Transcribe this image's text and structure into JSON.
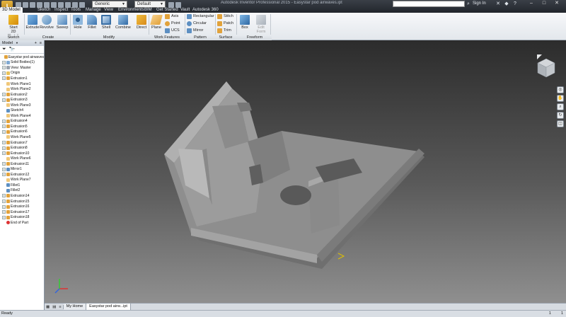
{
  "window": {
    "app_button": "I",
    "title": "Autodesk Inventor Professional 2015 - Easystar pod airwaves.ipt",
    "appearance_combo": "Generic",
    "material_combo": "Default",
    "search_placeholder": "",
    "sign_in": "Sign In"
  },
  "ribbon_tabs": [
    "3D Model",
    "Sketch",
    "Inspect",
    "Tools",
    "Manage",
    "View",
    "Environments",
    "BIM",
    "Get Started",
    "Vault",
    "Autodesk 360"
  ],
  "ribbon": {
    "sketch": {
      "start_sketch_line1": "Start",
      "start_sketch_line2": "2D Sketch",
      "panel": "Sketch"
    },
    "create": {
      "extrude": "Extrude",
      "revolve": "Revolve",
      "sweep": "Sweep",
      "panel": "Create"
    },
    "modify": {
      "hole": "Hole",
      "fillet": "Fillet",
      "shell": "Shell",
      "combine": "Combine",
      "direct": "Direct",
      "panel": "Modify"
    },
    "work_features": {
      "plane": "Plane",
      "axis": "Axis",
      "point": "Point",
      "ucs": "UCS",
      "panel": "Work Features"
    },
    "pattern": {
      "rectangular": "Rectangular",
      "circular": "Circular",
      "mirror": "Mirror",
      "panel": "Pattern"
    },
    "surface": {
      "stitch": "Stitch",
      "patch": "Patch",
      "trim": "Trim",
      "panel": "Surface"
    },
    "freeform": {
      "box": "Box",
      "edit_form_line1": "Edit",
      "edit_form_line2": "Form",
      "panel": "Freeform"
    }
  },
  "browser": {
    "header": "Model",
    "tree": [
      {
        "label": "Easystar pod airwaves",
        "icon": "part-icon",
        "expand": false,
        "indent": 0
      },
      {
        "label": "Solid Bodies(1)",
        "icon": "solid-bodies-icon",
        "expand": true,
        "indent": 1
      },
      {
        "label": "View: Master",
        "icon": "view-icon",
        "expand": true,
        "indent": 1
      },
      {
        "label": "Origin",
        "icon": "folder-icon",
        "expand": true,
        "indent": 1
      },
      {
        "label": "Extrusion1",
        "icon": "extrude-icon",
        "expand": true,
        "indent": 1
      },
      {
        "label": "Work Plane1",
        "icon": "work-plane-icon",
        "expand": false,
        "indent": 1
      },
      {
        "label": "Work Plane2",
        "icon": "work-plane-icon",
        "expand": false,
        "indent": 1
      },
      {
        "label": "Extrusion2",
        "icon": "extrude-icon",
        "expand": true,
        "indent": 1
      },
      {
        "label": "Extrusion3",
        "icon": "extrude-icon",
        "expand": true,
        "indent": 1
      },
      {
        "label": "Work Plane3",
        "icon": "work-plane-icon",
        "expand": false,
        "indent": 1
      },
      {
        "label": "Sketch4",
        "icon": "sketch-icon",
        "expand": false,
        "indent": 1
      },
      {
        "label": "Work Plane4",
        "icon": "work-plane-icon",
        "expand": false,
        "indent": 1
      },
      {
        "label": "Extrusion4",
        "icon": "extrude-icon",
        "expand": true,
        "indent": 1
      },
      {
        "label": "Extrusion5",
        "icon": "extrude-icon",
        "expand": true,
        "indent": 1
      },
      {
        "label": "Extrusion6",
        "icon": "extrude-icon",
        "expand": true,
        "indent": 1
      },
      {
        "label": "Work Plane5",
        "icon": "work-plane-icon",
        "expand": false,
        "indent": 1
      },
      {
        "label": "Extrusion7",
        "icon": "extrude-icon",
        "expand": true,
        "indent": 1
      },
      {
        "label": "Extrusion8",
        "icon": "extrude-icon",
        "expand": true,
        "indent": 1
      },
      {
        "label": "Extrusion10",
        "icon": "extrude-icon",
        "expand": true,
        "indent": 1
      },
      {
        "label": "Work Plane6",
        "icon": "work-plane-icon",
        "expand": false,
        "indent": 1
      },
      {
        "label": "Extrusion11",
        "icon": "extrude-icon",
        "expand": true,
        "indent": 1
      },
      {
        "label": "Mirror1",
        "icon": "mirror-icon",
        "expand": true,
        "indent": 1
      },
      {
        "label": "Extrusion12",
        "icon": "extrude-icon",
        "expand": true,
        "indent": 1
      },
      {
        "label": "Work Plane7",
        "icon": "work-plane-icon",
        "expand": false,
        "indent": 1
      },
      {
        "label": "Fillet1",
        "icon": "fillet-icon",
        "expand": false,
        "indent": 1
      },
      {
        "label": "Fillet2",
        "icon": "fillet-icon",
        "expand": false,
        "indent": 1
      },
      {
        "label": "Extrusion14",
        "icon": "extrude-icon",
        "expand": true,
        "indent": 1
      },
      {
        "label": "Extrusion15",
        "icon": "extrude-icon",
        "expand": true,
        "indent": 1
      },
      {
        "label": "Extrusion16",
        "icon": "extrude-icon",
        "expand": true,
        "indent": 1
      },
      {
        "label": "Extrusion17",
        "icon": "extrude-icon",
        "expand": true,
        "indent": 1
      },
      {
        "label": "Extrusion18",
        "icon": "extrude-icon",
        "expand": true,
        "indent": 1
      },
      {
        "label": "End of Part",
        "icon": "end-of-part-icon",
        "expand": false,
        "indent": 1
      }
    ]
  },
  "doc_tabs": [
    "My Home",
    "Easystar pod airw...ipt"
  ],
  "status": {
    "text": "Ready",
    "num1": "1",
    "num2": "1"
  },
  "colors": {
    "accent": "#e5b440",
    "viewport_top": "#2c2c2c",
    "viewport_bottom": "#8f8f8f",
    "part_face": "#9a9a9a"
  }
}
